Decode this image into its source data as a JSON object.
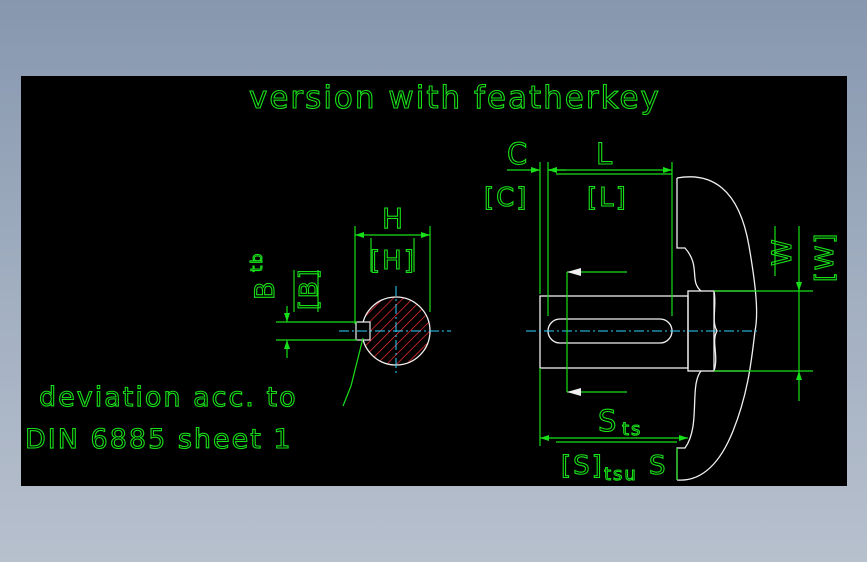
{
  "drawing": {
    "title": "version with featherkey",
    "note_line1": "deviation acc. to",
    "note_line2": "DIN 6885 sheet 1",
    "dim_H": "H",
    "dim_H_bracket": "[H]",
    "dim_B": "B",
    "dim_B_sub": "tb",
    "dim_B_bracket": "[B]",
    "dim_C": "C",
    "dim_C_bracket": "[C]",
    "dim_L": "L",
    "dim_L_bracket": "[L]",
    "dim_W": "W",
    "dim_W_bracket": "[W]",
    "dim_S": "S",
    "dim_S_sub": "ts",
    "dim_S_bracket": "[S]",
    "dim_S_bracket_sub": "tsu",
    "dim_S_plain": "S"
  },
  "colors": {
    "background": "#000000",
    "annotation": "#18e018",
    "outline": "#f0f0f0",
    "centerline": "#30d0ff",
    "hatch": "#ff3030"
  }
}
